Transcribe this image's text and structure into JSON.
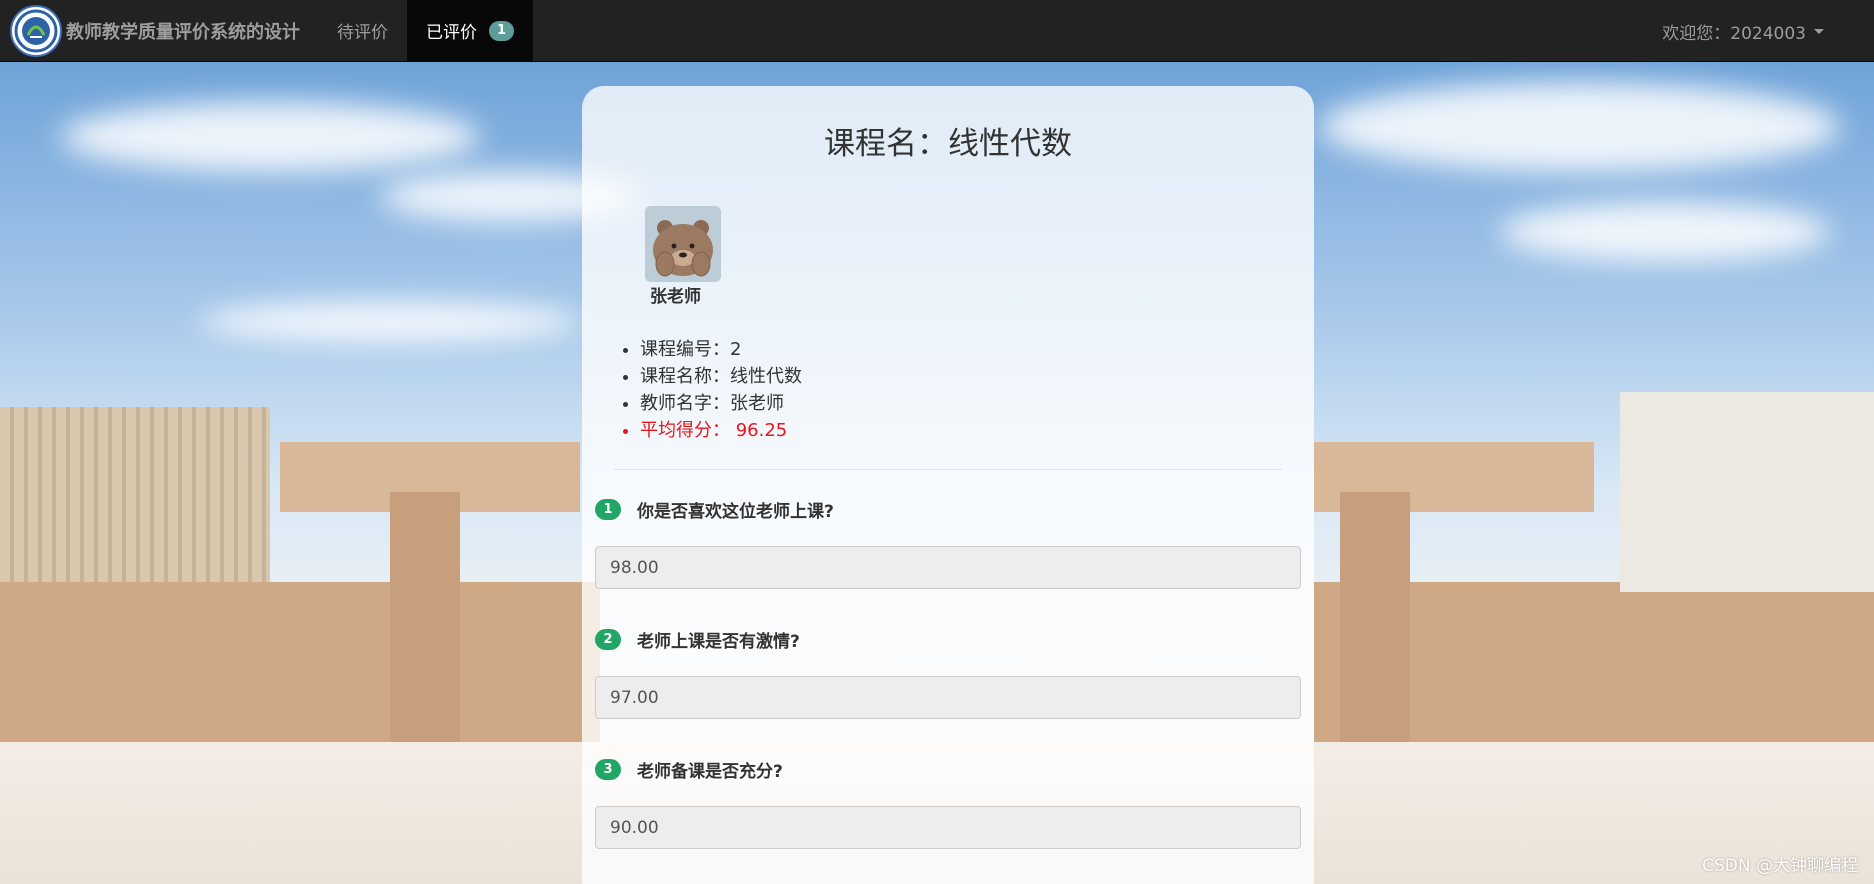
{
  "nav": {
    "brand": "教师教学质量评价系统的设计",
    "tabs": [
      {
        "label": "待评价"
      },
      {
        "label": "已评价",
        "badge": "1"
      }
    ],
    "user": "欢迎您：2024003"
  },
  "course": {
    "title": "课程名：线性代数",
    "teacher_name": "张老师",
    "info": [
      "课程编号：2",
      "课程名称：线性代数",
      "教师名字：张老师",
      "平均得分：  96.25"
    ]
  },
  "questions": [
    {
      "number": "1",
      "text": "你是否喜欢这位老师上课?",
      "value": "98.00"
    },
    {
      "number": "2",
      "text": "老师上课是否有激情?",
      "value": "97.00"
    },
    {
      "number": "3",
      "text": "老师备课是否充分?",
      "value": "90.00"
    }
  ],
  "watermark": "CSDN @大钟聊编程",
  "colors": {
    "navbar": "#222222",
    "active_tab": "#080808",
    "badge": "#5e9e9a",
    "question_number": "#21a665",
    "score_text": "#e8161d"
  }
}
